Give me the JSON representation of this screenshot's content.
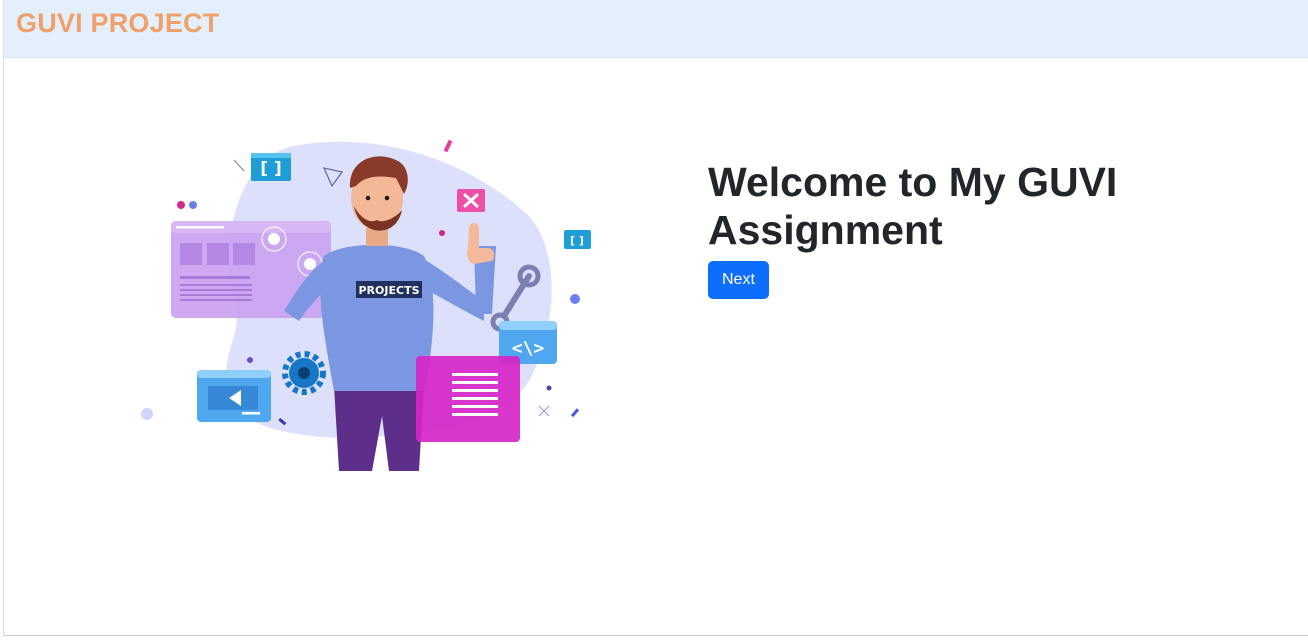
{
  "navbar": {
    "brand": "GUVI PROJECT"
  },
  "hero": {
    "title": "Welcome to My GUVI Assignment",
    "button_label": "Next",
    "illustration": {
      "shirt_text": "PROJECTS",
      "icons": [
        "brackets-icon",
        "close-icon",
        "code-icon",
        "gear-icon",
        "play-icon",
        "wrench-icon",
        "document-icon"
      ]
    }
  },
  "colors": {
    "brand": "#f0a06b",
    "navbar_bg": "#e3f0fb",
    "button": "#0d6efd",
    "title": "#22262a"
  }
}
